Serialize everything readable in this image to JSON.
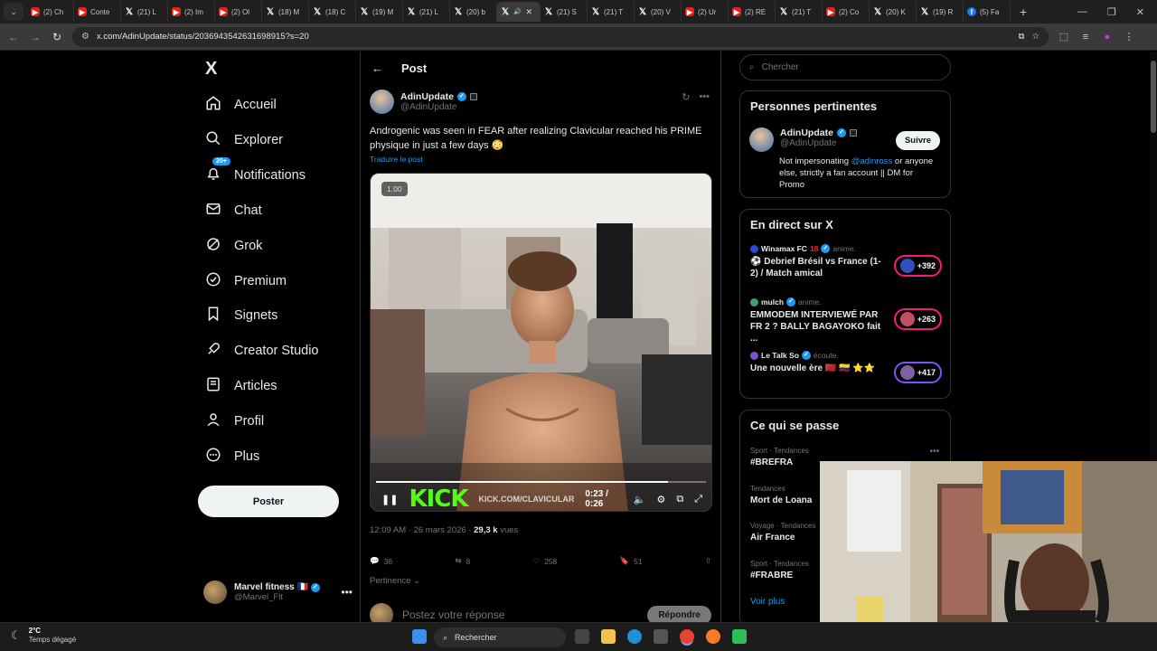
{
  "browser": {
    "tabs": [
      {
        "icon": "yt",
        "label": "(2) Ch"
      },
      {
        "icon": "yt",
        "label": "Conte"
      },
      {
        "icon": "x",
        "label": "(21) L"
      },
      {
        "icon": "yt",
        "label": "(2) Im"
      },
      {
        "icon": "yt",
        "label": "(2) Ol"
      },
      {
        "icon": "x",
        "label": "(18) M"
      },
      {
        "icon": "x",
        "label": "(18) C"
      },
      {
        "icon": "x",
        "label": "(19) M"
      },
      {
        "icon": "x",
        "label": "(21) L"
      },
      {
        "icon": "x",
        "label": "(20) b"
      },
      {
        "icon": "x",
        "label": "",
        "active": true
      },
      {
        "icon": "x",
        "label": "(21) S"
      },
      {
        "icon": "x",
        "label": "(21) T"
      },
      {
        "icon": "x",
        "label": "(20) V"
      },
      {
        "icon": "yt",
        "label": "(2) Ur"
      },
      {
        "icon": "yt",
        "label": "(2) RE"
      },
      {
        "icon": "x",
        "label": "(21) T"
      },
      {
        "icon": "yt",
        "label": "(2) Co"
      },
      {
        "icon": "x",
        "label": "(20) K"
      },
      {
        "icon": "x",
        "label": "(19) R"
      },
      {
        "icon": "fb",
        "label": "(5) Fa"
      }
    ],
    "url": "x.com/AdinUpdate/status/2036943542631698915?s=20"
  },
  "nav": {
    "logo": "X",
    "items": [
      {
        "label": "Accueil",
        "icon": "home-icon"
      },
      {
        "label": "Explorer",
        "icon": "search-icon"
      },
      {
        "label": "Notifications",
        "icon": "bell-icon",
        "badge": "20+"
      },
      {
        "label": "Chat",
        "icon": "mail-icon"
      },
      {
        "label": "Grok",
        "icon": "grok-icon"
      },
      {
        "label": "Premium",
        "icon": "premium-icon"
      },
      {
        "label": "Signets",
        "icon": "bookmark-icon"
      },
      {
        "label": "Creator Studio",
        "icon": "rocket-icon"
      },
      {
        "label": "Articles",
        "icon": "article-icon"
      },
      {
        "label": "Profil",
        "icon": "person-icon"
      },
      {
        "label": "Plus",
        "icon": "more-icon"
      }
    ],
    "post_button": "Poster",
    "account": {
      "name": "Marvel fitness 🇫🇷",
      "handle": "@Marvel_Flt"
    }
  },
  "post": {
    "header_title": "Post",
    "author_name": "AdinUpdate",
    "author_handle": "@AdinUpdate",
    "text": "Androgenic was seen in FEAR after realizing Clavicular reached his PRIME physique in just a few days 😳",
    "translate": "Traduire le post",
    "video": {
      "speed_badge": "1.00",
      "time": "0:23 / 0:26",
      "progress": 0.885,
      "watermark": "KICK",
      "watermark_url": "KICK.COM/CLAVICULAR"
    },
    "timestamp": "12:09 AM · 26 mars 2026",
    "views_count": "29,3 k",
    "views_label": "vues",
    "stats": {
      "replies": "36",
      "reposts": "8",
      "likes": "258",
      "bookmarks": "51"
    },
    "sort_label": "Pertinence",
    "reply_placeholder": "Postez votre réponse",
    "reply_button": "Répondre"
  },
  "sidebar": {
    "search_placeholder": "Chercher",
    "people": {
      "title": "Personnes pertinentes",
      "name": "AdinUpdate",
      "handle": "@AdinUpdate",
      "follow": "Suivre",
      "bio_pre": "Not impersonating ",
      "bio_mention": "@adinross",
      "bio_post": " or anyone else, strictly a fan account || DM for Promo"
    },
    "live": {
      "title": "En direct sur X",
      "items": [
        {
          "host": "Winamax FC",
          "extra": "18",
          "status": "anime.",
          "title": "⚽ Debrief Brésil vs France (1-2) / Match amical",
          "count": "+392"
        },
        {
          "host": "mulch",
          "extra": "",
          "status": "anime.",
          "title": "EMMODEM INTERVIEWÉ PAR FR 2 ? BALLY BAGAYOKO fait ...",
          "count": "+263"
        },
        {
          "host": "Le Talk So",
          "extra": "",
          "status": "écoute.",
          "title": "Une nouvelle ère 🇲🇦 🇨🇴 ⭐⭐",
          "count": "+417"
        }
      ]
    },
    "trends": {
      "title": "Ce qui se passe",
      "items": [
        {
          "category": "Sport · Tendances",
          "name": "#BREFRA"
        },
        {
          "category": "Tendances",
          "name": "Mort de Loana"
        },
        {
          "category": "Voyage · Tendances",
          "name": "Air France"
        },
        {
          "category": "Sport · Tendances",
          "name": "#FRABRE"
        }
      ],
      "more": "Voir plus"
    }
  },
  "taskbar": {
    "temp": "2°C",
    "condition": "Temps dégagé",
    "search": "Rechercher"
  },
  "colors": {
    "accent": "#1d9bf0",
    "bg": "#000000",
    "border": "#2f3336",
    "kick": "#53fc18",
    "live_pill": "#f91880"
  }
}
